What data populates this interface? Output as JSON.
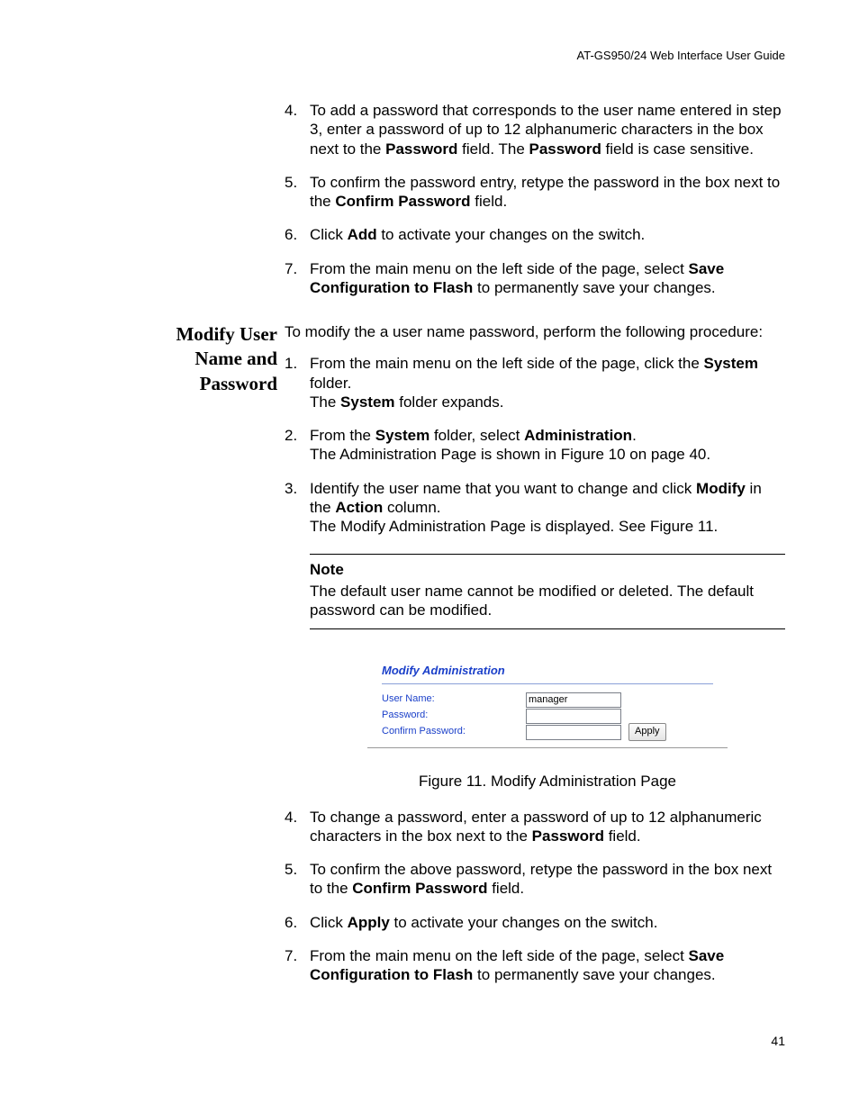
{
  "header": "AT-GS950/24  Web Interface User Guide",
  "page_number": "41",
  "top_steps": [
    {
      "num": "4.",
      "html": "To add a password that corresponds to the user name entered in step 3, enter a password of up to 12 alphanumeric characters in the box next to the <b>Password</b> field. The <b>Password</b> field is case sensitive."
    },
    {
      "num": "5.",
      "html": "To confirm the password entry, retype the password in the box next to the <b>Confirm Password</b> field."
    },
    {
      "num": "6.",
      "html": "Click <b>Add</b> to activate your changes on the switch."
    },
    {
      "num": "7.",
      "html": "From the main menu on the left side of the page, select <b>Save Configuration to Flash</b> to permanently save your changes."
    }
  ],
  "section_title": "Modify User Name and Password",
  "section_intro": "To modify the a user name password, perform the following procedure:",
  "section_steps_a": [
    {
      "num": "1.",
      "html": "From the main menu on the left side of the page, click the <b>System</b> folder.<br>The <b>System</b> folder expands."
    },
    {
      "num": "2.",
      "html": "From the <b>System</b> folder, select <b>Administration</b>.<br>The Administration Page is shown in Figure 10 on page 40."
    },
    {
      "num": "3.",
      "html": "Identify the user name that you want to change and click <b>Modify</b> in the <b>Action</b> column.<br>The Modify Administration Page is displayed. See Figure 11."
    }
  ],
  "note": {
    "title": "Note",
    "body": "The default user name cannot be modified or deleted. The default password can be modified."
  },
  "figure": {
    "title": "Modify Administration",
    "rows": {
      "username_label": "User Name:",
      "username_value": "manager",
      "password_label": "Password:",
      "confirm_label": "Confirm Password:"
    },
    "apply_label": "Apply",
    "caption": "Figure 11. Modify Administration Page"
  },
  "section_steps_b": [
    {
      "num": "4.",
      "html": "To change a password, enter a password of up to 12 alphanumeric characters in the box next to the <b>Password</b> field."
    },
    {
      "num": "5.",
      "html": "To confirm the above password, retype the password in the box next to the <b>Confirm Password</b> field."
    },
    {
      "num": "6.",
      "html": "Click <b>Apply</b> to activate your changes on the switch."
    },
    {
      "num": "7.",
      "html": "From the main menu on the left side of the page, select <b>Save Configuration to Flash</b> to permanently save your changes."
    }
  ]
}
